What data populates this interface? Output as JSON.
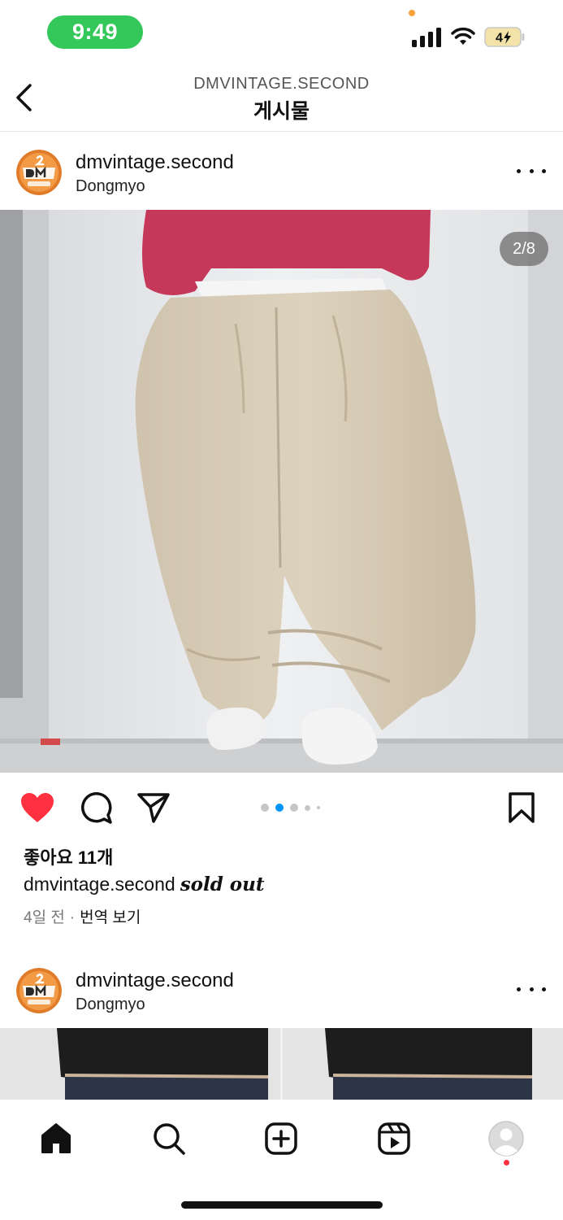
{
  "status_bar": {
    "time": "9:49",
    "battery": "4"
  },
  "header": {
    "subtitle": "DMVINTAGE.SECOND",
    "title": "게시물"
  },
  "post1": {
    "username": "dmvintage.second",
    "location": "Dongmyo",
    "image_counter": "2/8",
    "likes": "좋아요 11개",
    "caption_user": "dmvintage.second",
    "caption_text": "sold out",
    "time_ago": "4일 전",
    "separator": "·",
    "translate": "번역 보기",
    "carousel_active_index": 1,
    "carousel_total_dots": 5
  },
  "post2": {
    "username": "dmvintage.second",
    "location": "Dongmyo"
  },
  "icons": {
    "back": "chevron-left-icon",
    "like": "heart-filled-icon",
    "comment": "comment-icon",
    "share": "send-icon",
    "save": "bookmark-icon",
    "home": "home-icon",
    "search": "search-icon",
    "create": "plus-square-icon",
    "reels": "reels-icon",
    "profile": "profile-icon"
  },
  "colors": {
    "time_pill": "#34c759",
    "like": "#ff3040",
    "carousel_active": "#0095f6"
  }
}
